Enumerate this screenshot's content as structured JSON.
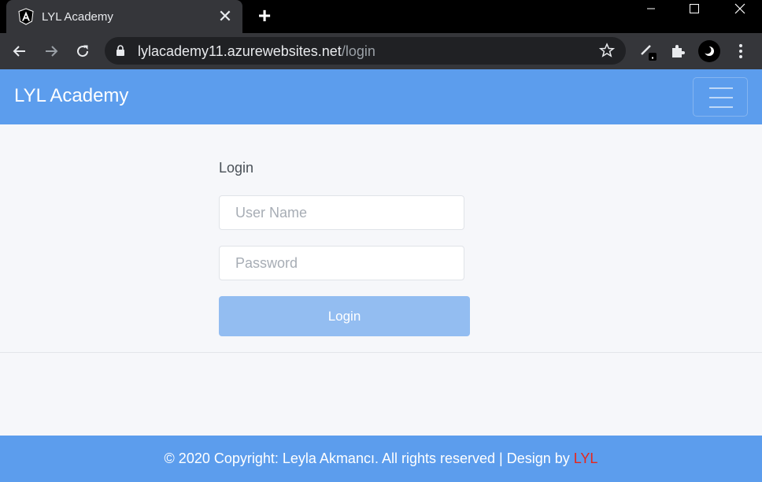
{
  "browser": {
    "tab_title": "LYL Academy",
    "tab_close": "✕",
    "new_tab": "+",
    "url_host": "lylacademy11.azurewebsites.net",
    "url_path": "/login"
  },
  "navbar": {
    "brand": "LYL Academy"
  },
  "login": {
    "title": "Login",
    "username_placeholder": "User Name",
    "password_placeholder": "Password",
    "button_label": "Login"
  },
  "footer": {
    "text": "© 2020 Copyright: Leyla Akmancı. All rights reserved | Design by ",
    "link_text": "LYL"
  },
  "colors": {
    "navbar": "#5c9ded",
    "button_disabled": "#93bdf1",
    "footer_link": "#e8251a"
  }
}
